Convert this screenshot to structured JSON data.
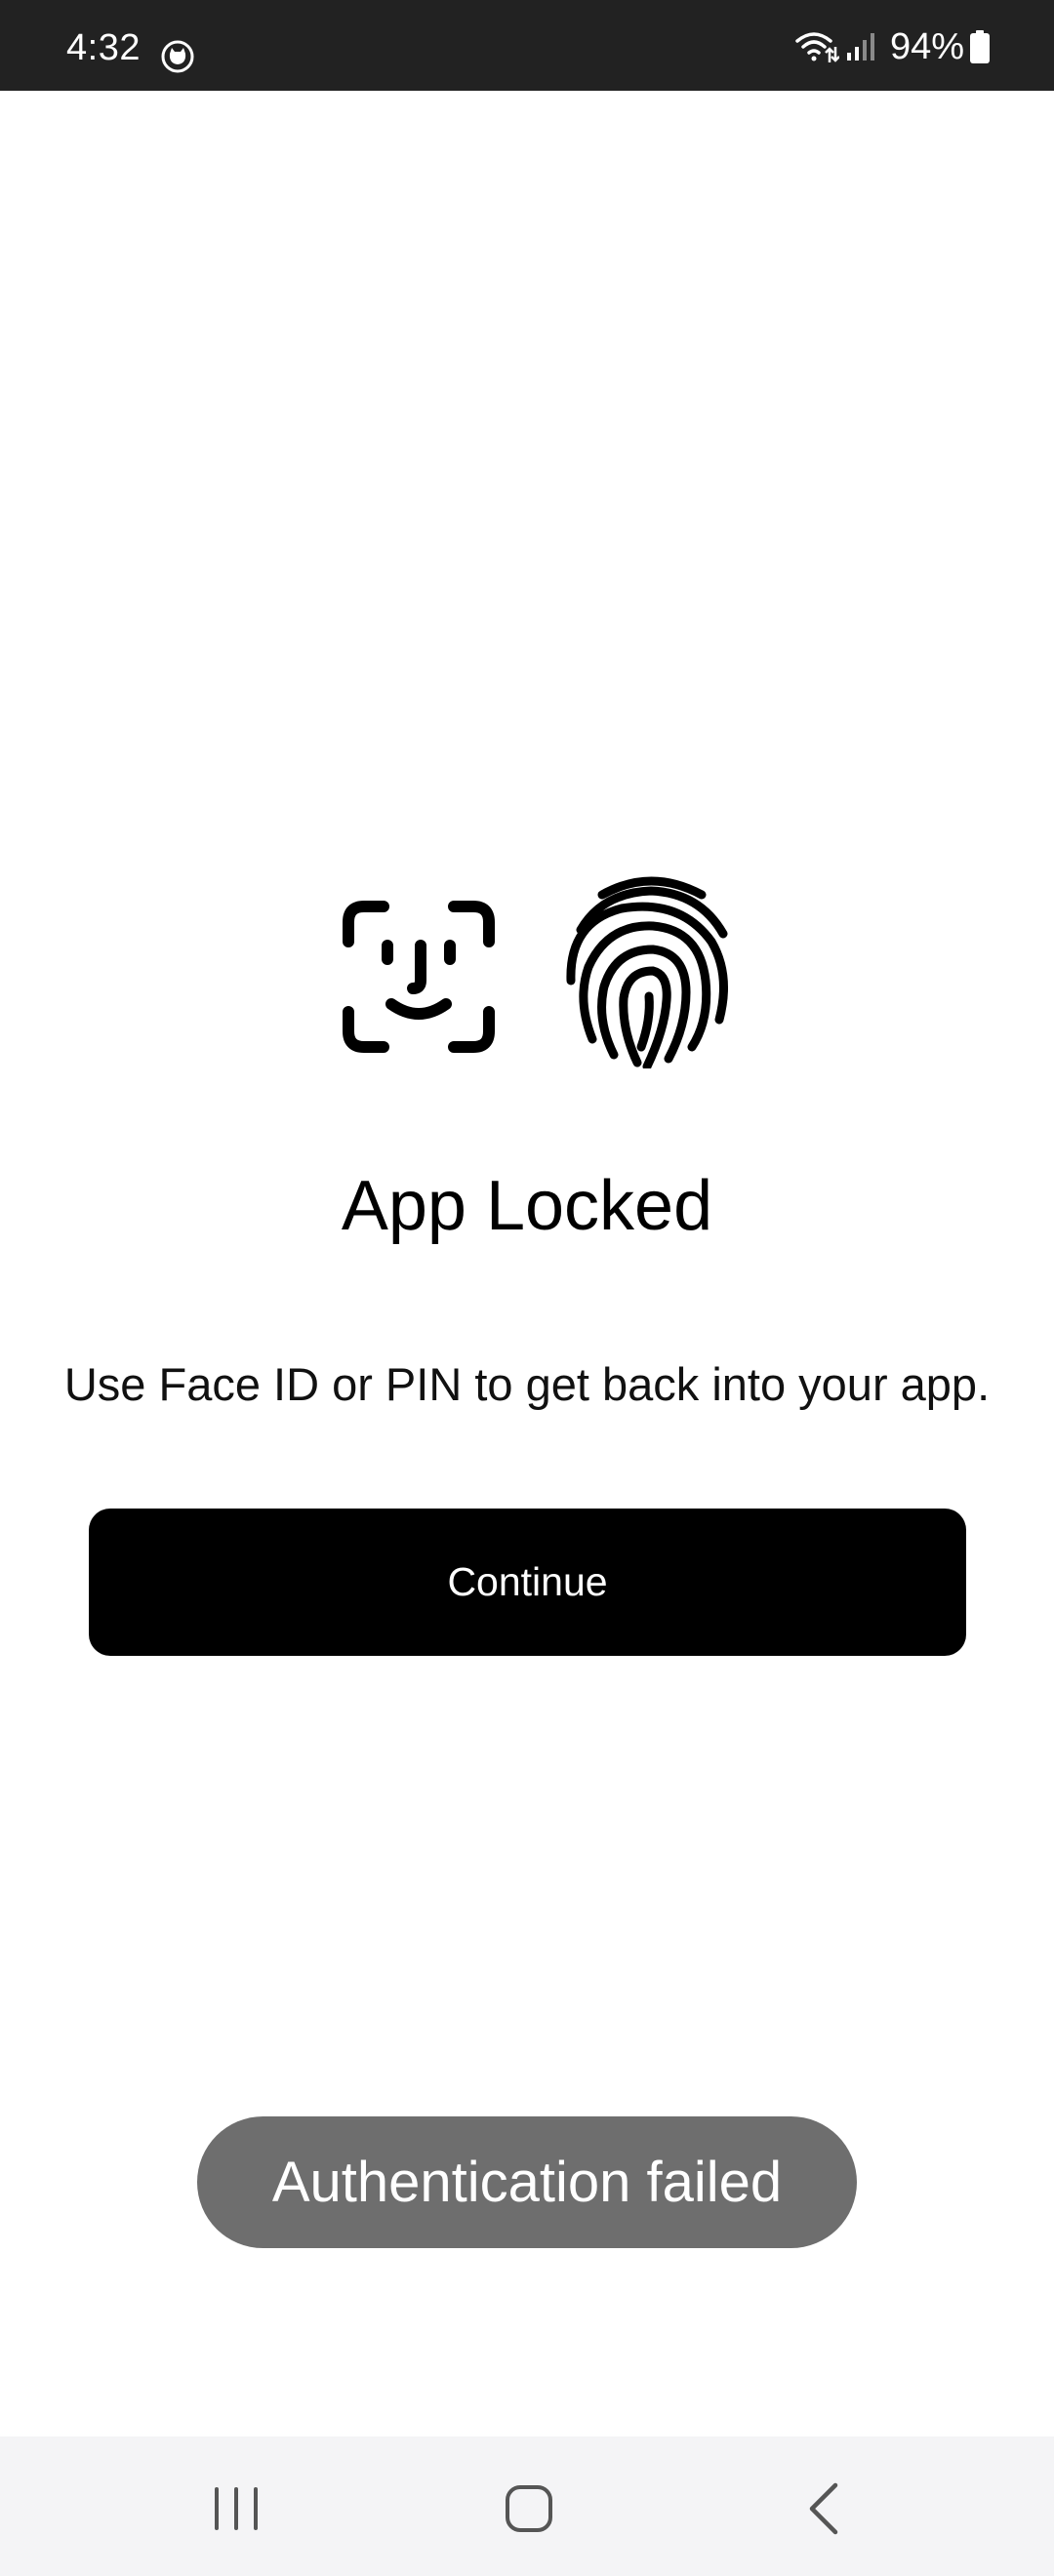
{
  "status_bar": {
    "time": "4:32",
    "battery": "94%",
    "app_icon": "cat-face-icon",
    "icons": [
      "wifi-icon",
      "signal-icon",
      "battery-icon"
    ]
  },
  "lock_screen": {
    "icons": [
      "face-id-icon",
      "fingerprint-icon"
    ],
    "title": "App Locked",
    "subtitle": "Use Face ID or PIN to get back into your app.",
    "continue_label": "Continue"
  },
  "toast": {
    "message": "Authentication failed"
  },
  "nav_bar": {
    "buttons": [
      "recents-icon",
      "home-icon",
      "back-icon"
    ]
  },
  "colors": {
    "status_bar_bg": "#222222",
    "button_bg": "#000000",
    "toast_bg": "#6e6e6e",
    "nav_bar_bg": "#f4f4f6"
  }
}
